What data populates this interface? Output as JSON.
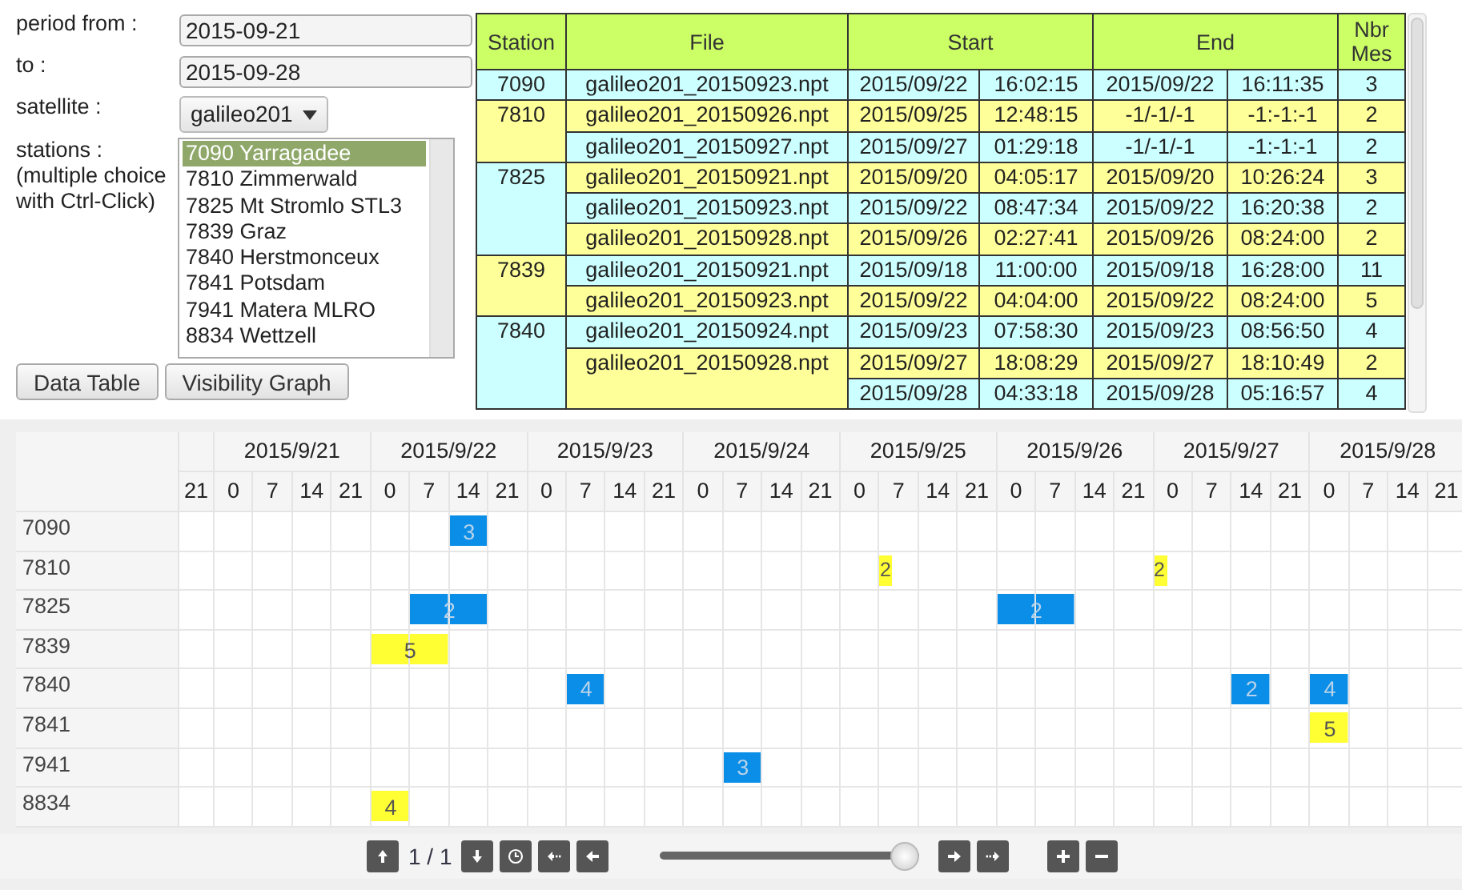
{
  "form": {
    "period_from": {
      "label": "period from :",
      "value": "2015-09-21"
    },
    "to": {
      "label": "to :",
      "value": "2015-09-28"
    },
    "satellite": {
      "label": "satellite :",
      "value": "galileo201"
    },
    "stations": {
      "label": "stations :",
      "hint": "(multiple choice with Ctrl-Click)",
      "options": [
        {
          "text": "7090 Yarragadee",
          "selected": true
        },
        {
          "text": "7810 Zimmerwald",
          "selected": false
        },
        {
          "text": "7825 Mt Stromlo STL3",
          "selected": false
        },
        {
          "text": "7839 Graz",
          "selected": false
        },
        {
          "text": "7840 Herstmonceux",
          "selected": false
        },
        {
          "text": "7841 Potsdam",
          "selected": false
        },
        {
          "text": "7941 Matera MLRO",
          "selected": false
        },
        {
          "text": "8834 Wettzell",
          "selected": false
        }
      ]
    },
    "buttons": [
      "Data Table",
      "Visibility Graph"
    ]
  },
  "table": {
    "columns": [
      "Station",
      "File",
      "Start",
      "End",
      "Nbr Mes"
    ],
    "stations": [
      {
        "station": "7090",
        "files": [
          {
            "file": "galileo201_20150923.npt",
            "passes": [
              {
                "start_date": "2015/09/22",
                "start_time": "16:02:15",
                "end_date": "2015/09/22",
                "end_time": "16:11:35",
                "nbr": "3"
              }
            ]
          }
        ]
      },
      {
        "station": "7810",
        "files": [
          {
            "file": "galileo201_20150926.npt",
            "passes": [
              {
                "start_date": "2015/09/25",
                "start_time": "12:48:15",
                "end_date": "-1/-1/-1",
                "end_time": "-1:-1:-1",
                "nbr": "2"
              }
            ]
          },
          {
            "file": "galileo201_20150927.npt",
            "passes": [
              {
                "start_date": "2015/09/27",
                "start_time": "01:29:18",
                "end_date": "-1/-1/-1",
                "end_time": "-1:-1:-1",
                "nbr": "2"
              }
            ]
          }
        ]
      },
      {
        "station": "7825",
        "files": [
          {
            "file": "galileo201_20150921.npt",
            "passes": [
              {
                "start_date": "2015/09/20",
                "start_time": "04:05:17",
                "end_date": "2015/09/20",
                "end_time": "10:26:24",
                "nbr": "3"
              }
            ]
          },
          {
            "file": "galileo201_20150923.npt",
            "passes": [
              {
                "start_date": "2015/09/22",
                "start_time": "08:47:34",
                "end_date": "2015/09/22",
                "end_time": "16:20:38",
                "nbr": "2"
              }
            ]
          },
          {
            "file": "galileo201_20150928.npt",
            "passes": [
              {
                "start_date": "2015/09/26",
                "start_time": "02:27:41",
                "end_date": "2015/09/26",
                "end_time": "08:24:00",
                "nbr": "2"
              }
            ]
          }
        ]
      },
      {
        "station": "7839",
        "files": [
          {
            "file": "galileo201_20150921.npt",
            "passes": [
              {
                "start_date": "2015/09/18",
                "start_time": "11:00:00",
                "end_date": "2015/09/18",
                "end_time": "16:28:00",
                "nbr": "11"
              }
            ]
          },
          {
            "file": "galileo201_20150923.npt",
            "passes": [
              {
                "start_date": "2015/09/22",
                "start_time": "04:04:00",
                "end_date": "2015/09/22",
                "end_time": "08:24:00",
                "nbr": "5"
              }
            ]
          }
        ]
      },
      {
        "station": "7840",
        "files": [
          {
            "file": "galileo201_20150924.npt",
            "passes": [
              {
                "start_date": "2015/09/23",
                "start_time": "07:58:30",
                "end_date": "2015/09/23",
                "end_time": "08:56:50",
                "nbr": "4"
              }
            ]
          },
          {
            "file": "galileo201_20150928.npt",
            "passes": [
              {
                "start_date": "2015/09/27",
                "start_time": "18:08:29",
                "end_date": "2015/09/27",
                "end_time": "18:10:49",
                "nbr": "2"
              },
              {
                "start_date": "2015/09/28",
                "start_time": "04:33:18",
                "end_date": "2015/09/28",
                "end_time": "05:16:57",
                "nbr": "4"
              }
            ]
          }
        ]
      }
    ]
  },
  "gantt": {
    "days": [
      {
        "hours": [
          "21"
        ]
      },
      {
        "date": "2015/9/21",
        "hours": [
          "0",
          "7",
          "14",
          "21"
        ]
      },
      {
        "date": "2015/9/22",
        "hours": [
          "0",
          "7",
          "14",
          "21"
        ]
      },
      {
        "date": "2015/9/23",
        "hours": [
          "0",
          "7",
          "14",
          "21"
        ]
      },
      {
        "date": "2015/9/24",
        "hours": [
          "0",
          "7",
          "14",
          "21"
        ]
      },
      {
        "date": "2015/9/25",
        "hours": [
          "0",
          "7",
          "14",
          "21"
        ]
      },
      {
        "date": "2015/9/26",
        "hours": [
          "0",
          "7",
          "14",
          "21"
        ]
      },
      {
        "date": "2015/9/27",
        "hours": [
          "0",
          "7",
          "14",
          "21"
        ]
      },
      {
        "date": "2015/9/28",
        "hours": [
          "0",
          "7",
          "14",
          "21"
        ]
      }
    ],
    "rows": [
      {
        "station": "7090",
        "occupied": [
          false,
          false,
          false,
          false,
          false,
          false,
          false,
          true,
          false,
          false,
          false,
          false,
          false,
          false,
          false,
          false,
          false,
          false,
          false,
          false,
          false,
          false,
          false,
          false,
          false,
          false,
          false,
          false,
          false,
          false,
          false,
          false,
          false
        ],
        "bars": [
          {
            "label": "3",
            "color": "#0a8ee8",
            "kind": "span"
          }
        ]
      },
      {
        "station": "7810",
        "occupied": [
          false,
          false,
          false,
          false,
          false,
          false,
          false,
          false,
          false,
          false,
          false,
          false,
          false,
          false,
          false,
          false,
          false,
          false,
          true,
          false,
          false,
          false,
          false,
          false,
          false,
          true,
          false,
          false,
          false,
          false,
          false,
          false,
          false
        ],
        "bars": [
          {
            "label": "2",
            "color": "#ffff33",
            "kind": "mark"
          },
          {
            "label": "2",
            "color": "#ffff33",
            "kind": "mark"
          }
        ]
      },
      {
        "station": "7825",
        "occupied": [
          false,
          false,
          false,
          false,
          false,
          false,
          true,
          true,
          false,
          false,
          false,
          false,
          false,
          false,
          false,
          false,
          false,
          false,
          false,
          false,
          false,
          true,
          true,
          false,
          false,
          false,
          false,
          false,
          false,
          false,
          false,
          false,
          false
        ],
        "bars": [
          {
            "label": "2",
            "color": "#0a8ee8",
            "kind": "span"
          },
          {
            "label": "2",
            "color": "#0a8ee8",
            "kind": "span"
          }
        ]
      },
      {
        "station": "7839",
        "occupied": [
          false,
          false,
          false,
          false,
          false,
          true,
          true,
          false,
          false,
          false,
          false,
          false,
          false,
          false,
          false,
          false,
          false,
          false,
          false,
          false,
          false,
          false,
          false,
          false,
          false,
          false,
          false,
          false,
          false,
          false,
          false,
          false,
          false
        ],
        "bars": [
          {
            "label": "5",
            "color": "#ffff33",
            "kind": "span"
          }
        ]
      },
      {
        "station": "7840",
        "occupied": [
          false,
          false,
          false,
          false,
          false,
          false,
          false,
          false,
          false,
          false,
          true,
          false,
          false,
          false,
          false,
          false,
          false,
          false,
          false,
          false,
          false,
          false,
          false,
          false,
          false,
          false,
          false,
          true,
          false,
          true,
          false,
          false,
          false
        ],
        "bars": [
          {
            "label": "4",
            "color": "#0a8ee8",
            "kind": "span"
          },
          {
            "label": "2",
            "color": "#0a8ee8",
            "kind": "span"
          },
          {
            "label": "4",
            "color": "#0a8ee8",
            "kind": "span"
          }
        ]
      },
      {
        "station": "7841",
        "occupied": [
          false,
          false,
          false,
          false,
          false,
          false,
          false,
          false,
          false,
          false,
          false,
          false,
          false,
          false,
          false,
          false,
          false,
          false,
          false,
          false,
          false,
          false,
          false,
          false,
          false,
          false,
          false,
          false,
          false,
          true,
          false,
          false,
          false
        ],
        "bars": [
          {
            "label": "5",
            "color": "#ffff33",
            "kind": "span"
          }
        ]
      },
      {
        "station": "7941",
        "occupied": [
          false,
          false,
          false,
          false,
          false,
          false,
          false,
          false,
          false,
          false,
          false,
          false,
          false,
          false,
          true,
          false,
          false,
          false,
          false,
          false,
          false,
          false,
          false,
          false,
          false,
          false,
          false,
          false,
          false,
          false,
          false,
          false,
          false
        ],
        "bars": [
          {
            "label": "3",
            "color": "#0a8ee8",
            "kind": "span"
          }
        ]
      },
      {
        "station": "8834",
        "occupied": [
          false,
          false,
          false,
          false,
          false,
          true,
          false,
          false,
          false,
          false,
          false,
          false,
          false,
          false,
          false,
          false,
          false,
          false,
          false,
          false,
          false,
          false,
          false,
          false,
          false,
          false,
          false,
          false,
          false,
          false,
          false,
          false,
          false
        ],
        "bars": [
          {
            "label": "4",
            "color": "#ffff33",
            "kind": "span"
          }
        ]
      }
    ]
  },
  "toolbar": {
    "page": "1 / 1",
    "slider": {
      "level": 1
    }
  }
}
